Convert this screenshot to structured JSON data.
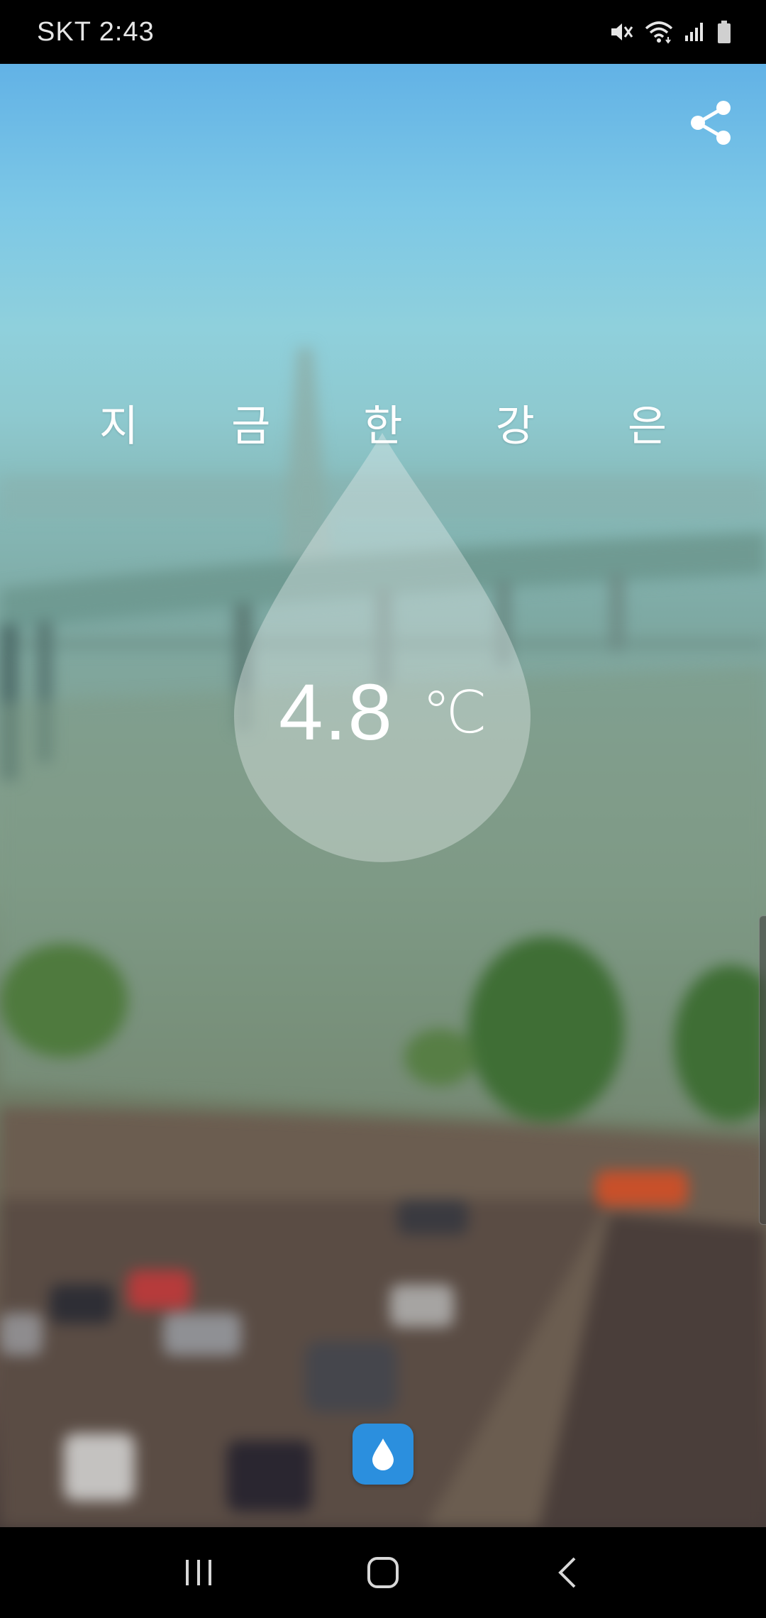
{
  "status_bar": {
    "carrier_time": "SKT 2:43",
    "icons": [
      "mute-icon",
      "wifi-icon",
      "signal-icon",
      "battery-icon"
    ]
  },
  "toolbar": {
    "share_icon": "share-icon"
  },
  "main": {
    "headline": "지 금 한 강 은",
    "temperature": "4.8",
    "unit": "℃"
  },
  "fab": {
    "icon": "water-drop-icon",
    "color": "#2b8fde"
  },
  "nav_bar": {
    "icons": [
      "recent-apps-icon",
      "home-icon",
      "back-icon"
    ]
  }
}
